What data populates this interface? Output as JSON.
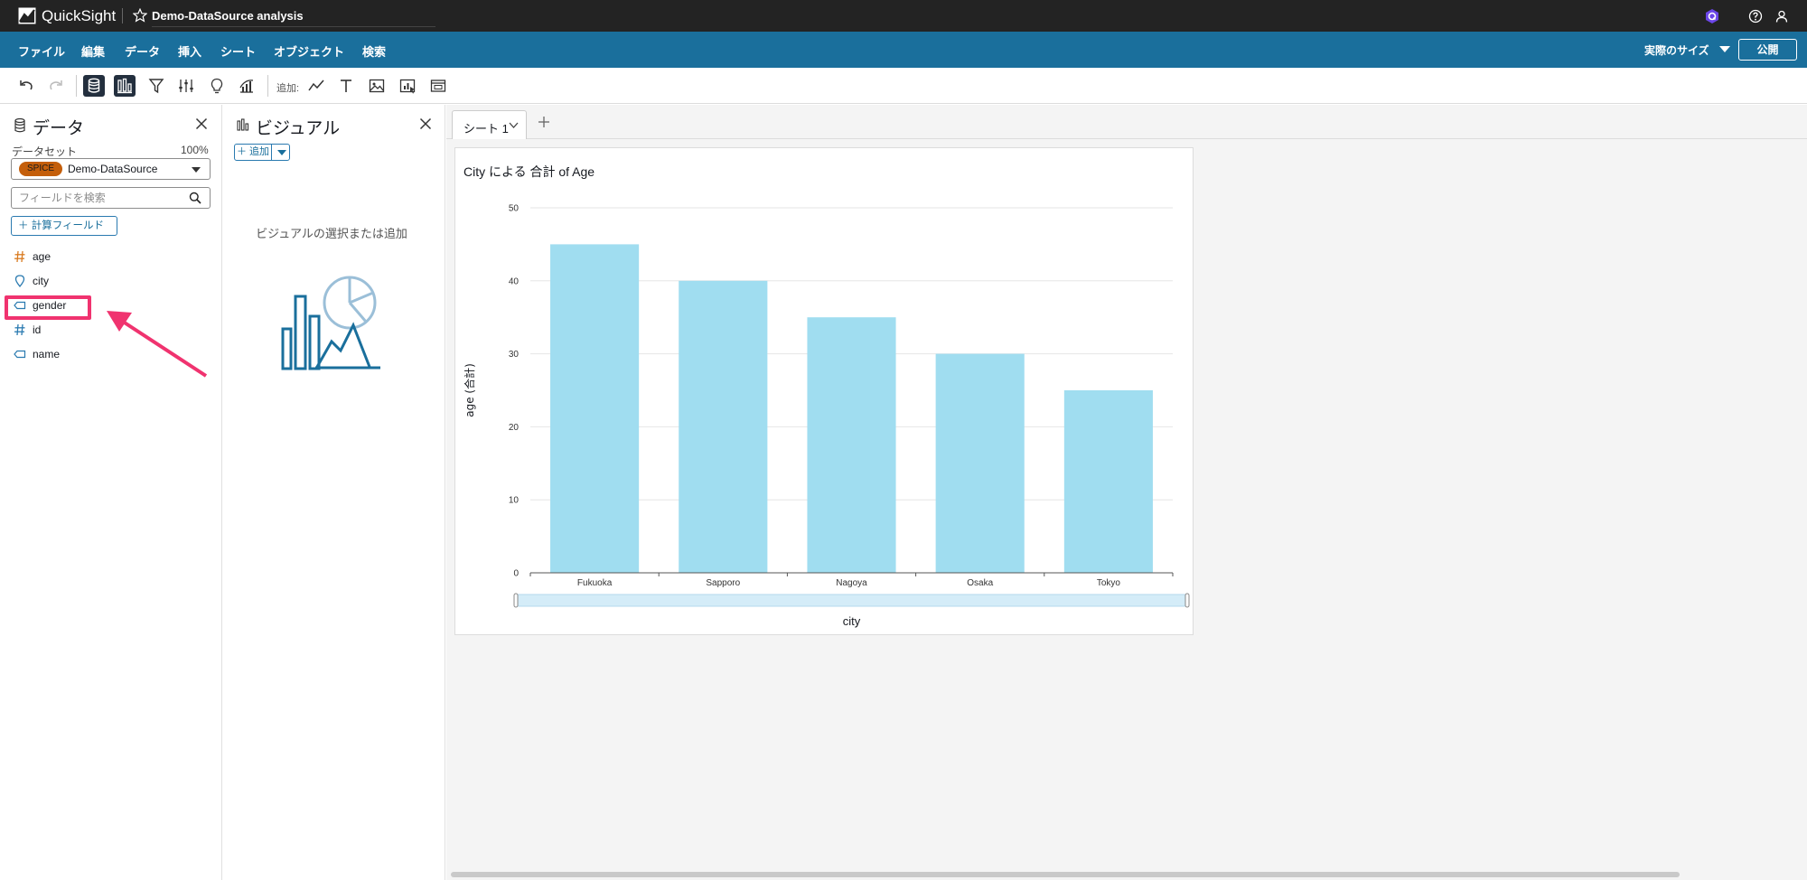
{
  "topbar": {
    "brand": "QuickSight",
    "analysis_name": "Demo-DataSource analysis"
  },
  "menubar": {
    "items": [
      "ファイル",
      "編集",
      "データ",
      "挿入",
      "シート",
      "オブジェクト",
      "検索"
    ],
    "view_size": "実際のサイズ",
    "publish": "公開"
  },
  "toolbar": {
    "add_label": "追加:"
  },
  "data_panel": {
    "title": "データ",
    "dataset_label": "データセット",
    "dataset_pct": "100%",
    "spice_badge": "SPICE",
    "dataset_name": "Demo-DataSource",
    "search_placeholder": "フィールドを検索",
    "search_value": "",
    "calc_field": "＋ 計算フィールド",
    "fields": [
      {
        "name": "age",
        "type": "number"
      },
      {
        "name": "city",
        "type": "geo"
      },
      {
        "name": "gender",
        "type": "text"
      },
      {
        "name": "id",
        "type": "number"
      },
      {
        "name": "name",
        "type": "text"
      }
    ],
    "highlight_color": "#f0336f"
  },
  "visual_panel": {
    "title": "ビジュアル",
    "add_button": "＋ 追加",
    "hint": "ビジュアルの選択または追加"
  },
  "sheet": {
    "tab_label": "シート 1"
  },
  "chart_data": {
    "type": "bar",
    "title": "City による 合計 of Age",
    "xlabel": "city",
    "ylabel": "age (合計)",
    "categories": [
      "Fukuoka",
      "Sapporo",
      "Nagoya",
      "Osaka",
      "Tokyo"
    ],
    "values": [
      45,
      40,
      35,
      30,
      25
    ],
    "ylim": [
      0,
      50
    ],
    "yticks": [
      0,
      10,
      20,
      30,
      40,
      50
    ],
    "grid": true,
    "bar_color": "#a0ddf0"
  },
  "colors": {
    "topbar": "#232323",
    "menubar": "#1a6f9c",
    "accent": "#1a6f9c"
  }
}
